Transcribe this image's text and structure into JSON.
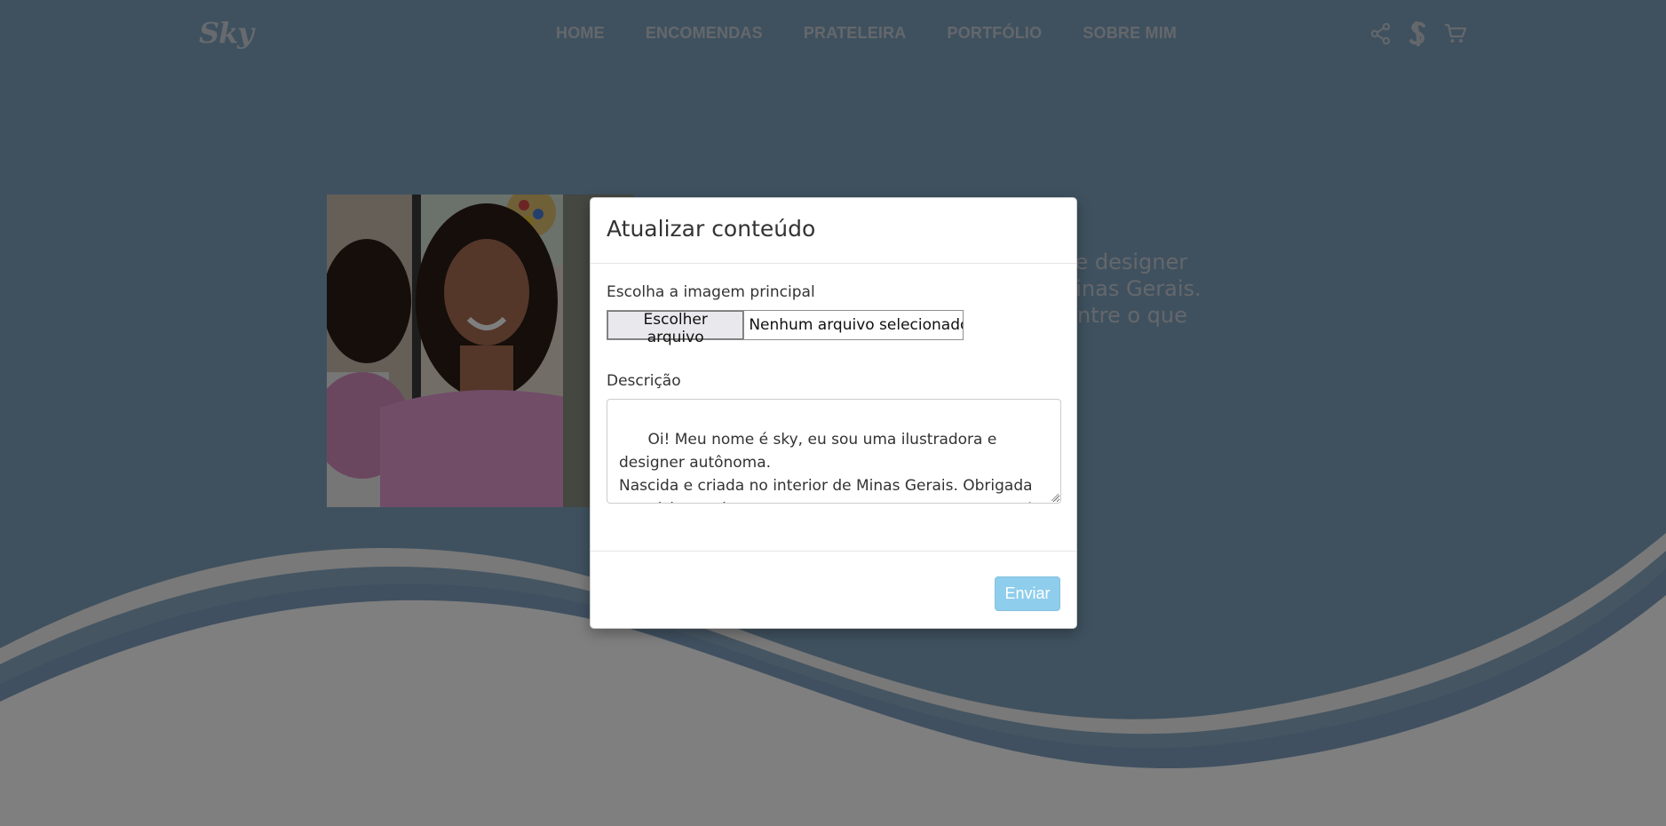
{
  "navbar": {
    "logo": "Sky",
    "links": [
      "HOME",
      "ENCOMENDAS",
      "PRATELEIRA",
      "PORTFÓLIO",
      "SOBRE MIM"
    ],
    "icons": [
      "share-icon",
      "sky-brand-icon",
      "cart-icon"
    ]
  },
  "hero": {
    "text_lines": [
      "lustradora e designer",
      "terior de Minas Gerais.",
      "o que encontre o que"
    ]
  },
  "modal": {
    "title": "Atualizar conteúdo",
    "image_label": "Escolha a imagem principal",
    "file_button": "Escolher arquivo",
    "file_status": "Nenhum arquivo selecionado",
    "description_label": "Descrição",
    "description_value": "Oi! Meu nome é sky, eu sou uma ilustradora e designer autônoma.\nNascida e criada no interior de Minas Gerais. Obrigada por visitar o site e espero que encontre o que procura!",
    "submit_label": "Enviar"
  },
  "colors": {
    "overlay": "#000000",
    "submit_button": "#8fcdec",
    "wave_purple": "#7f86c8",
    "wave_light": "#f2f2f2"
  }
}
